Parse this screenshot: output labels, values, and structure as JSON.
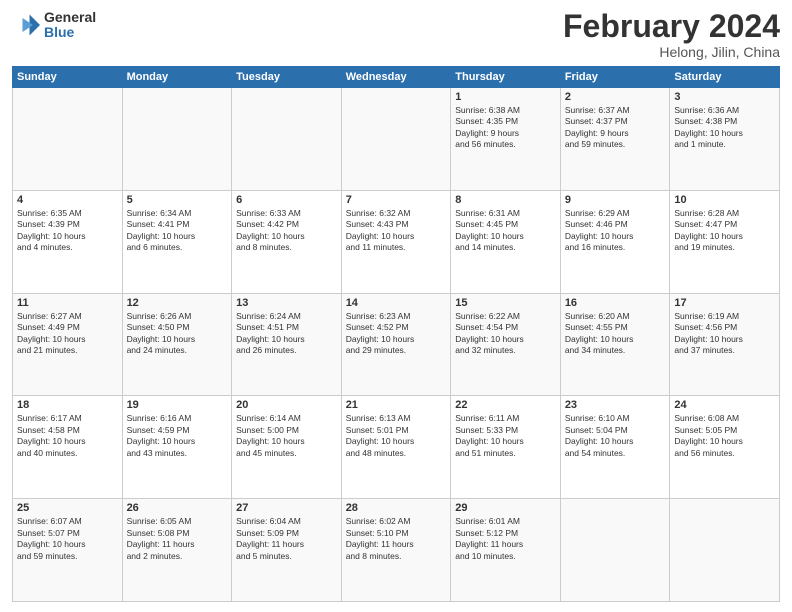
{
  "header": {
    "logo_general": "General",
    "logo_blue": "Blue",
    "month_title": "February 2024",
    "location": "Helong, Jilin, China"
  },
  "days_of_week": [
    "Sunday",
    "Monday",
    "Tuesday",
    "Wednesday",
    "Thursday",
    "Friday",
    "Saturday"
  ],
  "weeks": [
    [
      {
        "num": "",
        "info": ""
      },
      {
        "num": "",
        "info": ""
      },
      {
        "num": "",
        "info": ""
      },
      {
        "num": "",
        "info": ""
      },
      {
        "num": "1",
        "info": "Sunrise: 6:38 AM\nSunset: 4:35 PM\nDaylight: 9 hours\nand 56 minutes."
      },
      {
        "num": "2",
        "info": "Sunrise: 6:37 AM\nSunset: 4:37 PM\nDaylight: 9 hours\nand 59 minutes."
      },
      {
        "num": "3",
        "info": "Sunrise: 6:36 AM\nSunset: 4:38 PM\nDaylight: 10 hours\nand 1 minute."
      }
    ],
    [
      {
        "num": "4",
        "info": "Sunrise: 6:35 AM\nSunset: 4:39 PM\nDaylight: 10 hours\nand 4 minutes."
      },
      {
        "num": "5",
        "info": "Sunrise: 6:34 AM\nSunset: 4:41 PM\nDaylight: 10 hours\nand 6 minutes."
      },
      {
        "num": "6",
        "info": "Sunrise: 6:33 AM\nSunset: 4:42 PM\nDaylight: 10 hours\nand 8 minutes."
      },
      {
        "num": "7",
        "info": "Sunrise: 6:32 AM\nSunset: 4:43 PM\nDaylight: 10 hours\nand 11 minutes."
      },
      {
        "num": "8",
        "info": "Sunrise: 6:31 AM\nSunset: 4:45 PM\nDaylight: 10 hours\nand 14 minutes."
      },
      {
        "num": "9",
        "info": "Sunrise: 6:29 AM\nSunset: 4:46 PM\nDaylight: 10 hours\nand 16 minutes."
      },
      {
        "num": "10",
        "info": "Sunrise: 6:28 AM\nSunset: 4:47 PM\nDaylight: 10 hours\nand 19 minutes."
      }
    ],
    [
      {
        "num": "11",
        "info": "Sunrise: 6:27 AM\nSunset: 4:49 PM\nDaylight: 10 hours\nand 21 minutes."
      },
      {
        "num": "12",
        "info": "Sunrise: 6:26 AM\nSunset: 4:50 PM\nDaylight: 10 hours\nand 24 minutes."
      },
      {
        "num": "13",
        "info": "Sunrise: 6:24 AM\nSunset: 4:51 PM\nDaylight: 10 hours\nand 26 minutes."
      },
      {
        "num": "14",
        "info": "Sunrise: 6:23 AM\nSunset: 4:52 PM\nDaylight: 10 hours\nand 29 minutes."
      },
      {
        "num": "15",
        "info": "Sunrise: 6:22 AM\nSunset: 4:54 PM\nDaylight: 10 hours\nand 32 minutes."
      },
      {
        "num": "16",
        "info": "Sunrise: 6:20 AM\nSunset: 4:55 PM\nDaylight: 10 hours\nand 34 minutes."
      },
      {
        "num": "17",
        "info": "Sunrise: 6:19 AM\nSunset: 4:56 PM\nDaylight: 10 hours\nand 37 minutes."
      }
    ],
    [
      {
        "num": "18",
        "info": "Sunrise: 6:17 AM\nSunset: 4:58 PM\nDaylight: 10 hours\nand 40 minutes."
      },
      {
        "num": "19",
        "info": "Sunrise: 6:16 AM\nSunset: 4:59 PM\nDaylight: 10 hours\nand 43 minutes."
      },
      {
        "num": "20",
        "info": "Sunrise: 6:14 AM\nSunset: 5:00 PM\nDaylight: 10 hours\nand 45 minutes."
      },
      {
        "num": "21",
        "info": "Sunrise: 6:13 AM\nSunset: 5:01 PM\nDaylight: 10 hours\nand 48 minutes."
      },
      {
        "num": "22",
        "info": "Sunrise: 6:11 AM\nSunset: 5:33 PM\nDaylight: 10 hours\nand 51 minutes."
      },
      {
        "num": "23",
        "info": "Sunrise: 6:10 AM\nSunset: 5:04 PM\nDaylight: 10 hours\nand 54 minutes."
      },
      {
        "num": "24",
        "info": "Sunrise: 6:08 AM\nSunset: 5:05 PM\nDaylight: 10 hours\nand 56 minutes."
      }
    ],
    [
      {
        "num": "25",
        "info": "Sunrise: 6:07 AM\nSunset: 5:07 PM\nDaylight: 10 hours\nand 59 minutes."
      },
      {
        "num": "26",
        "info": "Sunrise: 6:05 AM\nSunset: 5:08 PM\nDaylight: 11 hours\nand 2 minutes."
      },
      {
        "num": "27",
        "info": "Sunrise: 6:04 AM\nSunset: 5:09 PM\nDaylight: 11 hours\nand 5 minutes."
      },
      {
        "num": "28",
        "info": "Sunrise: 6:02 AM\nSunset: 5:10 PM\nDaylight: 11 hours\nand 8 minutes."
      },
      {
        "num": "29",
        "info": "Sunrise: 6:01 AM\nSunset: 5:12 PM\nDaylight: 11 hours\nand 10 minutes."
      },
      {
        "num": "",
        "info": ""
      },
      {
        "num": "",
        "info": ""
      }
    ]
  ]
}
